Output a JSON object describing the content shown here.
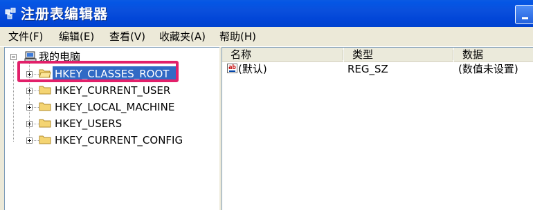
{
  "window": {
    "title": "注册表编辑器"
  },
  "menu": [
    {
      "label": "文件(F)"
    },
    {
      "label": "编辑(E)"
    },
    {
      "label": "查看(V)"
    },
    {
      "label": "收藏夹(A)"
    },
    {
      "label": "帮助(H)"
    }
  ],
  "tree": {
    "root": "我的电脑",
    "items": [
      {
        "label": "HKEY_CLASSES_ROOT",
        "selected": true
      },
      {
        "label": "HKEY_CURRENT_USER"
      },
      {
        "label": "HKEY_LOCAL_MACHINE"
      },
      {
        "label": "HKEY_USERS"
      },
      {
        "label": "HKEY_CURRENT_CONFIG"
      }
    ]
  },
  "list": {
    "columns": [
      "名称",
      "类型",
      "数据"
    ],
    "rows": [
      {
        "name": "(默认)",
        "type": "REG_SZ",
        "data": "(数值未设置)"
      }
    ]
  },
  "colors": {
    "selection": "#316ac5",
    "highlight_border": "#e2206a",
    "titlebar": "#0a4fdc",
    "folder": "#f4d472"
  },
  "icons": {
    "app": "registry-icon",
    "root": "computer-icon",
    "keys": "folder-icon",
    "value": "string-value-icon"
  }
}
